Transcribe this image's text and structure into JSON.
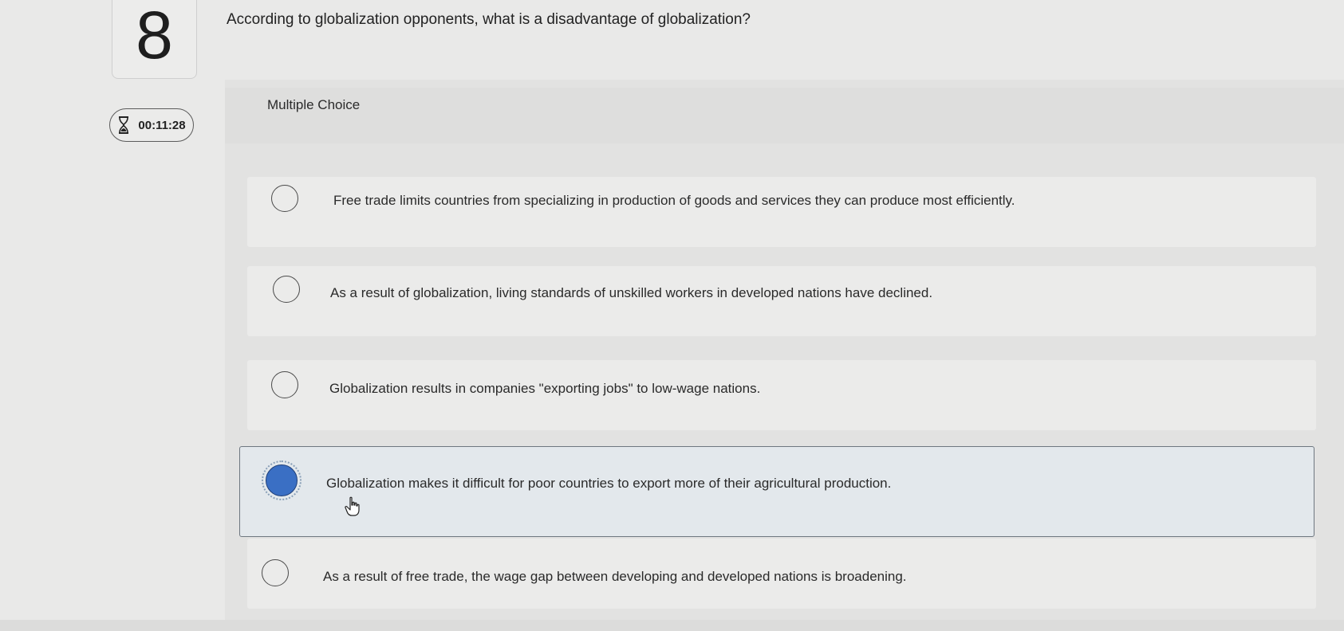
{
  "question": {
    "number": "8",
    "timer": "00:11:28",
    "prompt": "According to globalization opponents, what is a disadvantage of globalization?",
    "type_label": "Multiple Choice"
  },
  "choices": [
    {
      "text": "Free trade limits countries from specializing in production of goods and services they can produce most efficiently.",
      "selected": false
    },
    {
      "text": "As a result of globalization, living standards of unskilled workers in developed nations have declined.",
      "selected": false
    },
    {
      "text": "Globalization results in companies \"exporting jobs\" to low-wage nations.",
      "selected": false
    },
    {
      "text": "Globalization makes it difficult for poor countries to export more of their agricultural production.",
      "selected": true
    },
    {
      "text": "As a result of free trade, the wage gap between developing and developed nations is broadening.",
      "selected": false
    }
  ],
  "colors": {
    "selected_radio": "#3a6fc4",
    "selected_row_bg": "#e3e8ec"
  },
  "icons": [
    "hourglass-icon",
    "hand-pointer-icon"
  ]
}
